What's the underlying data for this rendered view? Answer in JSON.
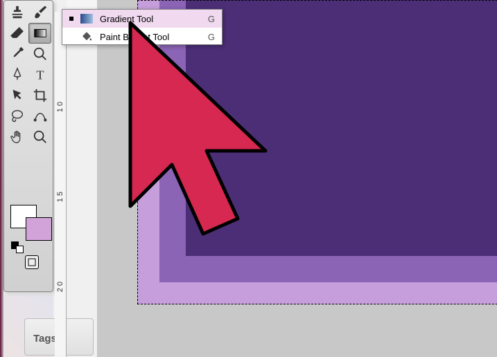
{
  "tools": {
    "row1": [
      "stamp-tool",
      "brush-tool"
    ],
    "row2": [
      "eraser-tool",
      "gradient-tool"
    ],
    "row3": [
      "eyedropper-tool",
      "zoom-tool"
    ],
    "row4": [
      "pen-tool",
      "type-tool"
    ],
    "row5": [
      "selection-tool",
      "crop-tool"
    ],
    "row6": [
      "lasso-tool",
      "path-tool"
    ],
    "row7": [
      "hand-tool",
      "magnify-tool"
    ]
  },
  "swatch": {
    "fill": "#ffffff",
    "stroke": "#d1a3d9"
  },
  "panels": {
    "tags_label": "Tags"
  },
  "ruler": {
    "v_marks": [
      "1\n0",
      "1\n5",
      "2\n0"
    ]
  },
  "flyout": {
    "items": [
      {
        "label": "Gradient Tool",
        "key": "G",
        "selected": true,
        "icon": "gradient"
      },
      {
        "label": "Paint Bucket Tool",
        "key": "G",
        "selected": false,
        "icon": "bucket"
      }
    ]
  }
}
